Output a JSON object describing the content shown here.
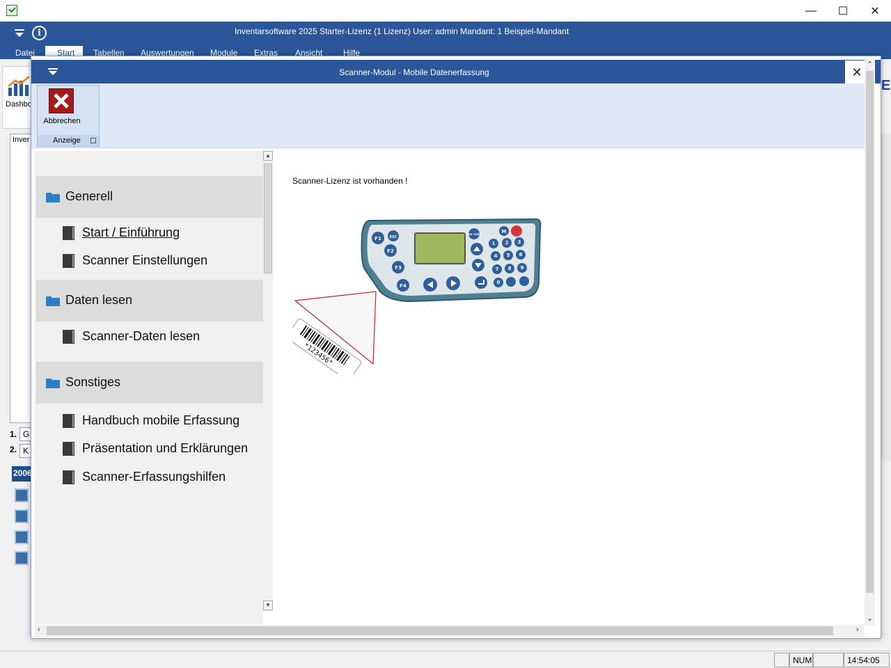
{
  "outer_window": {
    "title": "Inventarsoftware 2025 Starter-Lizenz (1 Lizenz)   User: admin    Mandant: 1 Beispiel-Mandant",
    "controls": {
      "minimize": "—",
      "maximize": "☐",
      "close": "✕"
    },
    "info_symbol": "i"
  },
  "ribbon_tabs": [
    "Datei",
    "Start",
    "Tabellen",
    "Auswertungen",
    "Module",
    "Extras",
    "Ansicht",
    "Hilfe"
  ],
  "background": {
    "dashboard_label": "Dashbo",
    "tree_label": "Inver",
    "rows": [
      {
        "num": "1.",
        "value": "G"
      },
      {
        "num": "2.",
        "value": "K"
      }
    ],
    "year": "2006",
    "right_letter": "E"
  },
  "statusbar": {
    "num": "NUM",
    "time": "14:54:05"
  },
  "modal": {
    "title": "Scanner-Modul - Mobile Datenerfassung",
    "close_symbol": "✕",
    "ribbon": {
      "cancel_label": "Abbrechen",
      "group_label": "Anzeige"
    },
    "nav": {
      "sections": [
        {
          "header": "Generell",
          "items": [
            "Start / Einführung",
            "Scanner Einstellungen"
          ]
        },
        {
          "header": "Daten lesen",
          "items": [
            "Scanner-Daten lesen"
          ]
        },
        {
          "header": "Sonstiges",
          "items": [
            "Handbuch mobile Erfassung",
            "Präsentation und Erklärungen",
            "Scanner-Erfassungshilfen"
          ]
        }
      ]
    },
    "content": {
      "license_text": "Scanner-Lizenz ist vorhanden !",
      "illustration": {
        "keys": [
          "F1",
          "ESC",
          "F2",
          "F3",
          "F4",
          "M",
          "Bar code",
          "1",
          "2",
          "3",
          "4",
          "5",
          "6",
          "7",
          "8",
          "9",
          "0"
        ],
        "barcode_text": "*123456*"
      }
    }
  }
}
